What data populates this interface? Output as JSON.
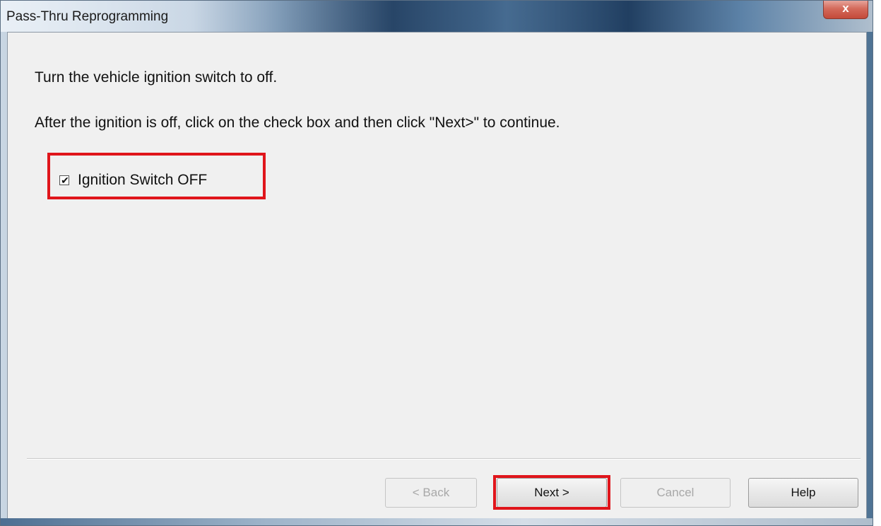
{
  "window": {
    "title": "Pass-Thru Reprogramming",
    "close_glyph": "x"
  },
  "content": {
    "instruction_1": "Turn the vehicle ignition switch to off.",
    "instruction_2": "After the ignition is off, click on the check box and then click \"Next>\" to continue.",
    "checkbox": {
      "label": "Ignition Switch OFF",
      "checked": true,
      "mark": "✔"
    }
  },
  "buttons": {
    "back_label": "< Back",
    "next_label": "Next >",
    "cancel_label": "Cancel",
    "help_label": "Help"
  },
  "colors": {
    "highlight": "#e0151b",
    "dialog_bg": "#f0f0f0"
  }
}
